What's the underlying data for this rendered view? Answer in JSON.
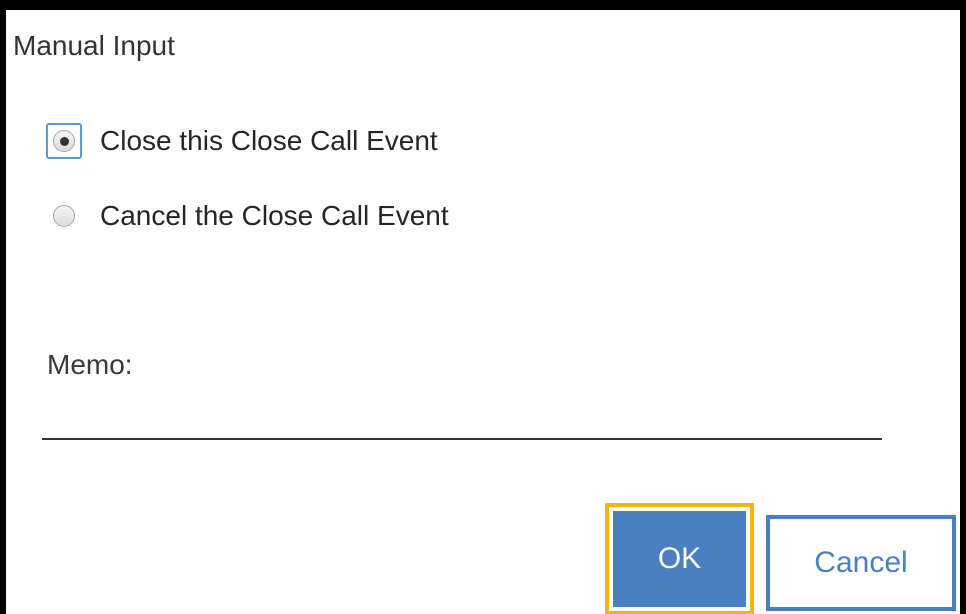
{
  "dialog": {
    "title": "Manual Input",
    "options": [
      {
        "label": "Close this Close Call Event",
        "selected": true
      },
      {
        "label": "Cancel the Close Call Event",
        "selected": false
      }
    ],
    "memo": {
      "label": "Memo:",
      "value": ""
    },
    "buttons": {
      "ok_label": "OK",
      "cancel_label": "Cancel"
    }
  },
  "colors": {
    "primary": "#4a7fc1",
    "focus_outline": "#f2b705",
    "frame": "#000000"
  }
}
